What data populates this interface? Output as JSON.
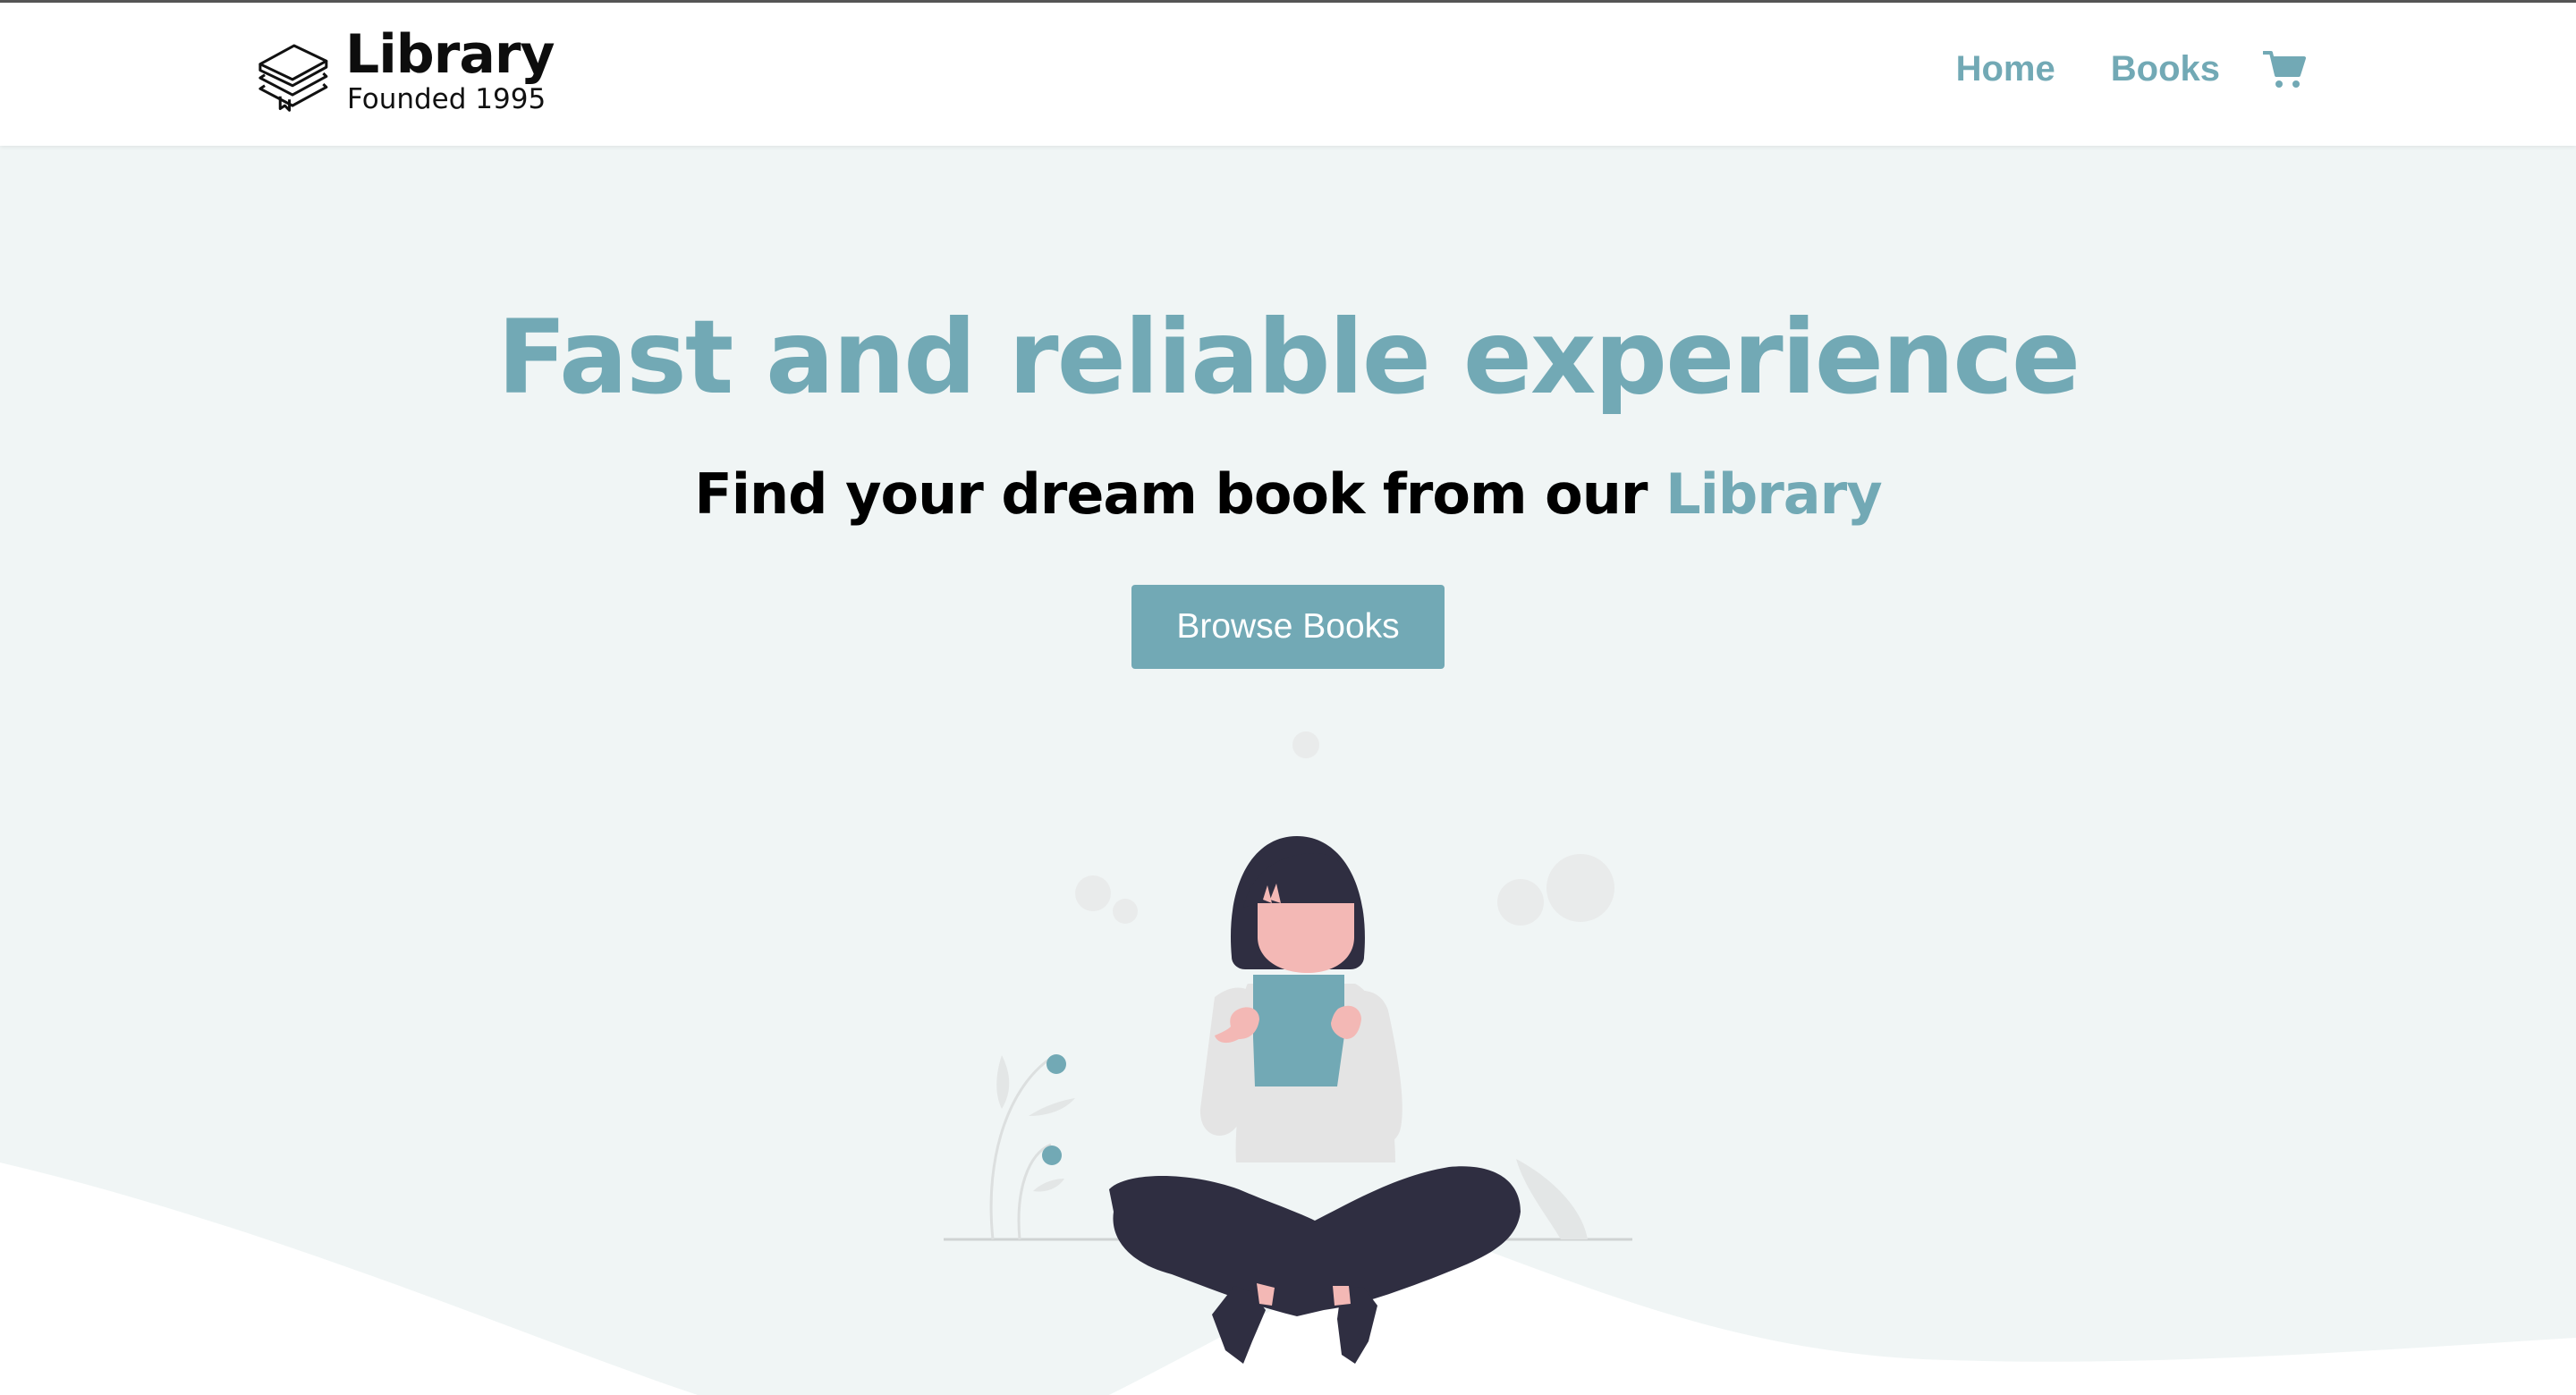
{
  "brand": {
    "name": "Library",
    "tagline": "Founded 1995",
    "logo_icon": "stacked-books-icon"
  },
  "nav": {
    "items": [
      {
        "label": "Home"
      },
      {
        "label": "Books"
      }
    ],
    "cart_icon": "shopping-cart-icon"
  },
  "hero": {
    "title": "Fast and reliable experience",
    "subtitle_prefix": "Find your dream book from our ",
    "subtitle_accent": "Library",
    "cta_label": "Browse Books"
  },
  "colors": {
    "accent": "#72a9b5",
    "background": "#f0f5f5",
    "text": "#000000",
    "navbar_bg": "#ffffff"
  }
}
